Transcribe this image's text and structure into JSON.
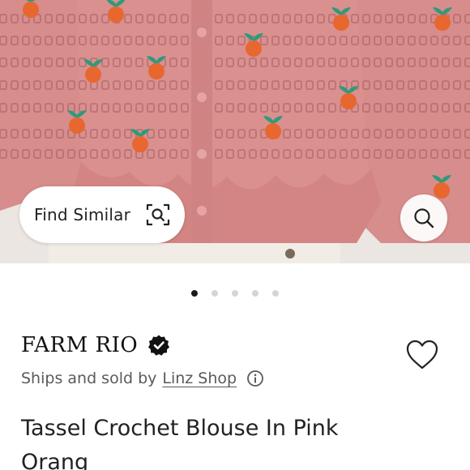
{
  "image": {
    "alt": "pink crochet cardigan",
    "colors": {
      "knit": "#d98f8e",
      "fruit": "#e8672f",
      "leaf": "#2f9a7a",
      "background": "#e9e4df"
    }
  },
  "find_similar": {
    "label": "Find Similar",
    "icon": "scan-search-icon"
  },
  "search_button": {
    "icon": "search-icon"
  },
  "carousel": {
    "count": 5,
    "active_index": 0
  },
  "brand": {
    "name": "FARM RIO",
    "verified_icon": "verified-badge-icon"
  },
  "seller": {
    "prefix": "Ships and sold by",
    "shop_name": "Linz Shop",
    "info_icon": "info-icon"
  },
  "like": {
    "icon": "heart-outline-icon"
  },
  "product": {
    "title": "Tassel Crochet Blouse In Pink Orang"
  }
}
